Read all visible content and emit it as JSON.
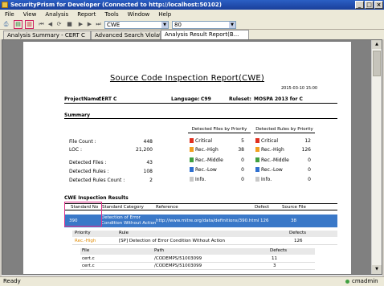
{
  "window": {
    "title": "SecurityPrism for Developer (Connected to http://localhost:50102)"
  },
  "menu": [
    "File",
    "View",
    "Analysis",
    "Report",
    "Tools",
    "Window",
    "Help"
  ],
  "toolbar": {
    "standard_combo": "CWE",
    "rule_combo": "80"
  },
  "tabs": [
    "Analysis Summary - CERT C",
    "Advanced Search Violation",
    "Analysis Result Report(B..."
  ],
  "report": {
    "title": "Source Code Inspection Report(CWE)",
    "date": "2015-03-10 15:00",
    "project_label": "ProjectName:",
    "project_value": "CERT C",
    "language_label": "Language:",
    "language_value": "C99",
    "ruleset_label": "Ruleset:",
    "ruleset_value": "MOSPA 2013 for C",
    "summary_title": "Summary",
    "files_by_priority_title": "Detected Files by Priority",
    "rules_by_priority_title": "Detected Rules by Priority",
    "stats": [
      {
        "label": "File Count :",
        "value": "448"
      },
      {
        "label": "LOC :",
        "value": "21,200"
      },
      {
        "label": "Detected Files :",
        "value": "43"
      },
      {
        "label": "Detected Rules :",
        "value": "108"
      },
      {
        "label": "Detected Rules Count :",
        "value": "2"
      }
    ],
    "priorities": [
      {
        "name": "Critical",
        "files": "5",
        "rules": "12",
        "color": "#e03020"
      },
      {
        "name": "Rec.-High",
        "files": "38",
        "rules": "126",
        "color": "#f0a020"
      },
      {
        "name": "Rec.-Middle",
        "files": "0",
        "rules": "0",
        "color": "#40a040"
      },
      {
        "name": "Rec.-Low",
        "files": "0",
        "rules": "0",
        "color": "#3070d0"
      },
      {
        "name": "Info.",
        "files": "0",
        "rules": "0",
        "color": "#c8c8c8"
      }
    ],
    "cwe_title": "CWE Inspection Results",
    "cwe_headers": {
      "std": "Standard No",
      "cat": "Standard Category",
      "ref": "Reference",
      "defect": "Defect",
      "src": "Source File"
    },
    "cwe_row": {
      "std": "390",
      "cat1": "Detection of Error",
      "cat2": "Condition Without Action",
      "ref": "http://www.mitre.org/data/definitions/390.html",
      "defect": "126",
      "src": "38"
    },
    "sub_header": {
      "priority": "Priority",
      "rule": "Rule",
      "defects": "Defects"
    },
    "sub_row": {
      "priority": "Rec.-High",
      "rule": "[SP] Detection of Error Condition Without Action",
      "defects": "126"
    },
    "file_header": {
      "file": "File",
      "path": "Path",
      "defects": "Defects"
    },
    "files": [
      {
        "file": "cert.c",
        "path": "/CODEMPS/51003099",
        "defects": "11"
      },
      {
        "file": "cert.c",
        "path": "/CODEMPS/51003099",
        "defects": "3"
      }
    ]
  },
  "status": {
    "text": "Ready",
    "user": "cmadmin"
  }
}
